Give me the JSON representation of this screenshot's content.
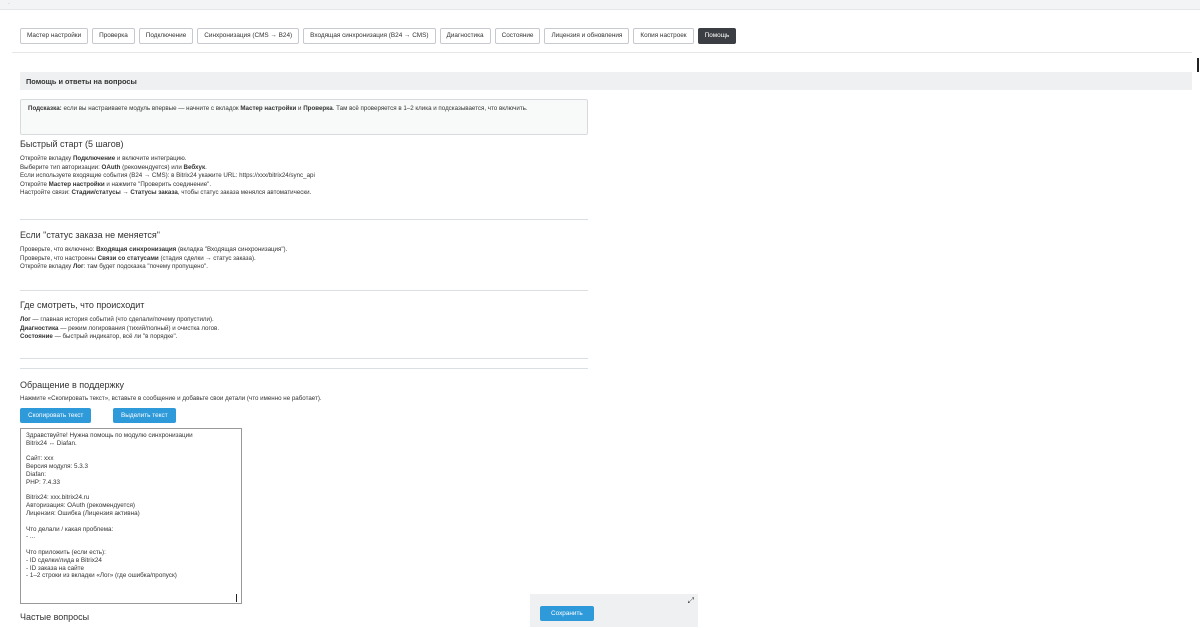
{
  "tabs": [
    {
      "label": "Мастер настройки"
    },
    {
      "label": "Проверка"
    },
    {
      "label": "Подключение"
    },
    {
      "label": "Синхронизация (CMS → B24)"
    },
    {
      "label": "Входящая синхронизация (B24 → CMS)"
    },
    {
      "label": "Диагностика"
    },
    {
      "label": "Состояние"
    },
    {
      "label": "Лицензия и обновления"
    },
    {
      "label": "Копия настроек"
    },
    {
      "label": "Помощь",
      "active": true
    }
  ],
  "section_title": "Помощь и ответы на вопросы",
  "hint": {
    "label": "Подсказка:",
    "text1": " если вы настраиваете модуль впервые — начните с вкладок ",
    "b1": "Мастер настройки",
    "t2": " и ",
    "b2": "Проверка",
    "t3": ". Там всё проверяется в 1–2 клика и подсказывается, что включить."
  },
  "quickstart": {
    "title": "Быстрый старт (5 шагов)",
    "l1a": "Откройте вкладку ",
    "l1b": "Подключение",
    "l1c": " и включите интеграцию.",
    "l2a": "Выберите тип авторизации: ",
    "l2b": "OAuth",
    "l2c": " (рекомендуется) или ",
    "l2d": "Вебхук",
    "l2e": ".",
    "l3": "Если используете входящие события (B24 → CMS): в Bitrix24 укажите URL: https://xxx/bitrix24/sync_api",
    "l4a": "Откройте ",
    "l4b": "Мастер настройки",
    "l4c": " и нажмите \"Проверить соединение\".",
    "l5a": "Настройте связи: ",
    "l5b": "Стадии/статусы → Статусы заказа",
    "l5c": ", чтобы статус заказа менялся автоматически."
  },
  "status_issue": {
    "title": "Если \"статус заказа не меняется\"",
    "l1a": "Проверьте, что включено: ",
    "l1b": "Входящая синхронизация",
    "l1c": " (вкладка \"Входящая синхронизация\").",
    "l2a": "Проверьте, что настроены ",
    "l2b": "Связи со статусами",
    "l2c": " (стадия сделки → статус заказа).",
    "l3a": "Откройте вкладку ",
    "l3b": "Лог",
    "l3c": ": там будет подсказка \"почему пропущено\"."
  },
  "where": {
    "title": "Где смотреть, что происходит",
    "l1a": "Лог",
    "l1b": " — главная история событий (что сделали/почему пропустили).",
    "l2a": "Диагностика",
    "l2b": " — режим логирования (тихий/полный) и очистка логов.",
    "l3a": "Состояние",
    "l3b": " — быстрый индикатор, всё ли \"в порядке\"."
  },
  "support": {
    "title": "Обращение в поддержку",
    "desc": "Нажмите «Скопировать текст», вставьте в сообщение и добавьте свои детали (что именно не работает).",
    "copy_label": "Скопировать текст",
    "select_label": "Выделить текст",
    "message": "Здравствуйте! Нужна помощь по модулю синхронизации\nBitrix24 ↔ Diafan.\n\nСайт: xxx\nВерсия модуля: 5.3.3\nDiafan:\nPHP: 7.4.33\n\nBitrix24: xxx.bitrix24.ru\nАвторизация: OAuth (рекомендуется)\nЛицензия: Ошибка (Лицензия активна)\n\nЧто делали / какая проблема:\n- ...\n\nЧто приложить (если есть):\n- ID сделки/лида в Bitrix24\n- ID заказа на сайте\n- 1–2 строки из вкладки «Лог» (где ошибка/пропуск)"
  },
  "faq_title": "Частые вопросы",
  "save_label": "Сохранить",
  "icons": {
    "expand": "expand-icon"
  },
  "colors": {
    "accent": "#2f9ad9",
    "active_tab": "#3b3e42",
    "section_bg": "#eef0f1"
  }
}
